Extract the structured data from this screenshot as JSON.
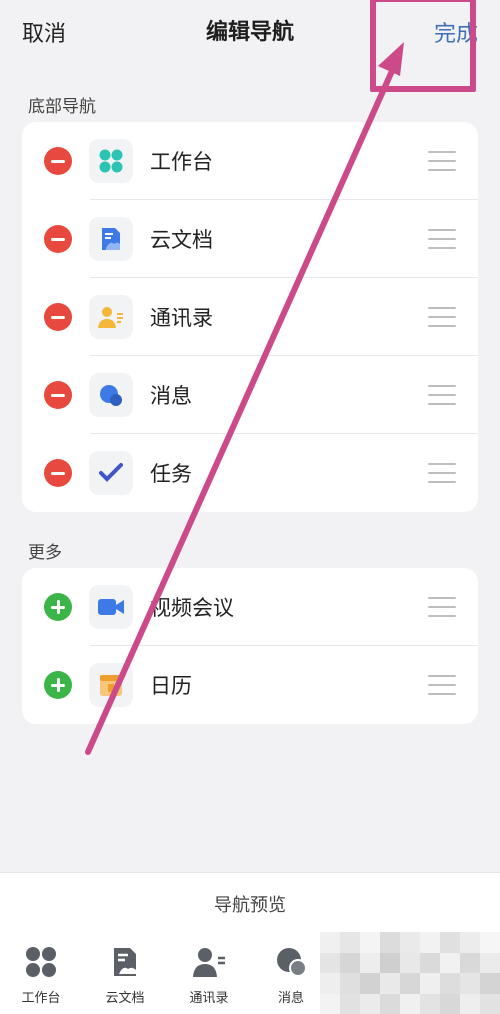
{
  "header": {
    "cancel_label": "取消",
    "title": "编辑导航",
    "done_label": "完成"
  },
  "bottom_nav_section": {
    "title": "底部导航",
    "items": [
      {
        "label": "工作台",
        "icon": "grid-icon",
        "action": "remove"
      },
      {
        "label": "云文档",
        "icon": "document-icon",
        "action": "remove"
      },
      {
        "label": "通讯录",
        "icon": "contacts-icon",
        "action": "remove"
      },
      {
        "label": "消息",
        "icon": "message-icon",
        "action": "remove"
      },
      {
        "label": "任务",
        "icon": "task-check-icon",
        "action": "remove"
      }
    ]
  },
  "more_section": {
    "title": "更多",
    "items": [
      {
        "label": "视频会议",
        "icon": "video-camera-icon",
        "action": "add"
      },
      {
        "label": "日历",
        "icon": "calendar-icon",
        "action": "add"
      }
    ]
  },
  "preview": {
    "title": "导航预览",
    "tabs": [
      {
        "label": "工作台",
        "icon": "grid-icon"
      },
      {
        "label": "云文档",
        "icon": "document-icon"
      },
      {
        "label": "通讯录",
        "icon": "contacts-icon"
      },
      {
        "label": "消息",
        "icon": "message-icon"
      }
    ]
  },
  "colors": {
    "accent_blue": "#3f6fb6",
    "remove_red": "#e8493f",
    "add_green": "#3bb548",
    "annotation_pink": "#cc4a8a"
  }
}
